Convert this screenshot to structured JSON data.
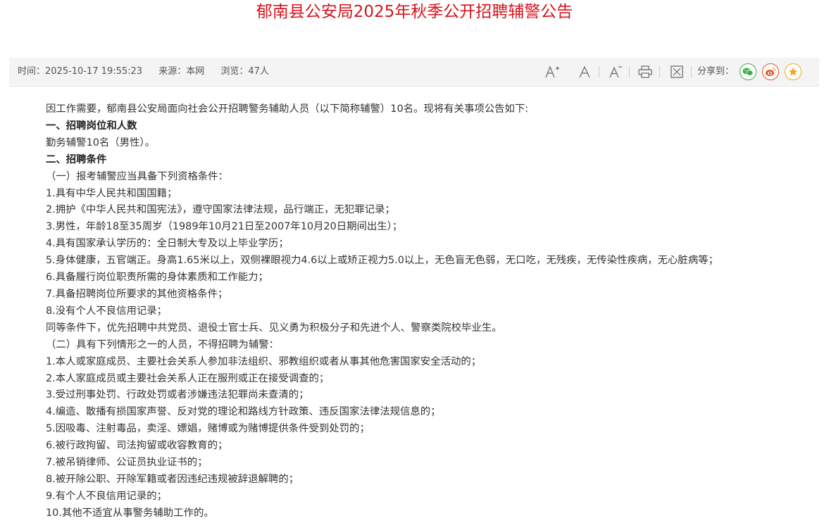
{
  "page": {
    "title": "郁南县公安局2025年秋季公开招聘辅警公告",
    "title_color": "#d6141c"
  },
  "meta": {
    "time": "时间：2025-10-17 19:55:23",
    "source": "来源：本网",
    "views": "浏览：47人"
  },
  "toolbar": {
    "icons": [
      "font-increase-icon",
      "font-normal-icon",
      "font-decrease-icon",
      "print-icon",
      "close-icon"
    ],
    "share_label": "分享到：",
    "share_buttons": [
      "wechat-icon",
      "weibo-icon",
      "favorite-icon"
    ],
    "colors": {
      "wechat": "#3ab04a",
      "weibo": "#e8542b",
      "favorite": "#f0a81d"
    }
  },
  "article": {
    "paragraphs": [
      {
        "text": "因工作需要，郁南县公安局面向社会公开招聘警务辅助人员（以下简称辅警）10名。现将有关事项公告如下:",
        "heading": false
      },
      {
        "text": "一、招聘岗位和人数",
        "heading": true
      },
      {
        "text": "勤务辅警10名（男性）。",
        "heading": false
      },
      {
        "text": "二、招聘条件",
        "heading": true
      },
      {
        "text": "（一）报考辅警应当具备下列资格条件：",
        "heading": false
      },
      {
        "text": "1.具有中华人民共和国国籍；",
        "heading": false
      },
      {
        "text": "2.拥护《中华人民共和国宪法》，遵守国家法律法规，品行端正，无犯罪记录；",
        "heading": false
      },
      {
        "text": "3.男性，年龄18至35周岁（1989年10月21日至2007年10月20日期间出生）；",
        "heading": false
      },
      {
        "text": "4.具有国家承认学历的：全日制大专及以上毕业学历；",
        "heading": false
      },
      {
        "text": "5.身体健康，五官端正。身高1.65米以上，双侧裸眼视力4.6以上或矫正视力5.0以上，无色盲无色弱，无口吃，无残疾，无传染性疾病，无心脏病等；",
        "heading": false
      },
      {
        "text": "6.具备履行岗位职责所需的身体素质和工作能力；",
        "heading": false
      },
      {
        "text": "7.具备招聘岗位所要求的其他资格条件；",
        "heading": false
      },
      {
        "text": "8.没有个人不良信用记录；",
        "heading": false
      },
      {
        "text": "同等条件下，优先招聘中共党员、退役士官士兵、见义勇为积极分子和先进个人、警察类院校毕业生。",
        "heading": false
      },
      {
        "text": "（二）具有下列情形之一的人员，不得招聘为辅警：",
        "heading": false
      },
      {
        "text": "1.本人或家庭成员、主要社会关系人参加非法组织、邪教组织或者从事其他危害国家安全活动的；",
        "heading": false
      },
      {
        "text": "2.本人家庭成员或主要社会关系人正在服刑或正在接受调查的；",
        "heading": false
      },
      {
        "text": "3.受过刑事处罚、行政处罚或者涉嫌违法犯罪尚未查清的；",
        "heading": false
      },
      {
        "text": "4.编造、散播有损国家声誉、反对党的理论和路线方针政策、违反国家法律法规信息的；",
        "heading": false
      },
      {
        "text": "5.因吸毒、注射毒品，卖淫、嫖娼，赌博或为赌博提供条件受到处罚的；",
        "heading": false
      },
      {
        "text": "6.被行政拘留、司法拘留或收容教育的；",
        "heading": false
      },
      {
        "text": "7.被吊销律师、公证员执业证书的；",
        "heading": false
      },
      {
        "text": "8.被开除公职、开除军籍或者因违纪违规被辞退解聘的；",
        "heading": false
      },
      {
        "text": "9.有个人不良信用记录的；",
        "heading": false
      },
      {
        "text": "10.其他不适宜从事警务辅助工作的。",
        "heading": false
      }
    ]
  }
}
